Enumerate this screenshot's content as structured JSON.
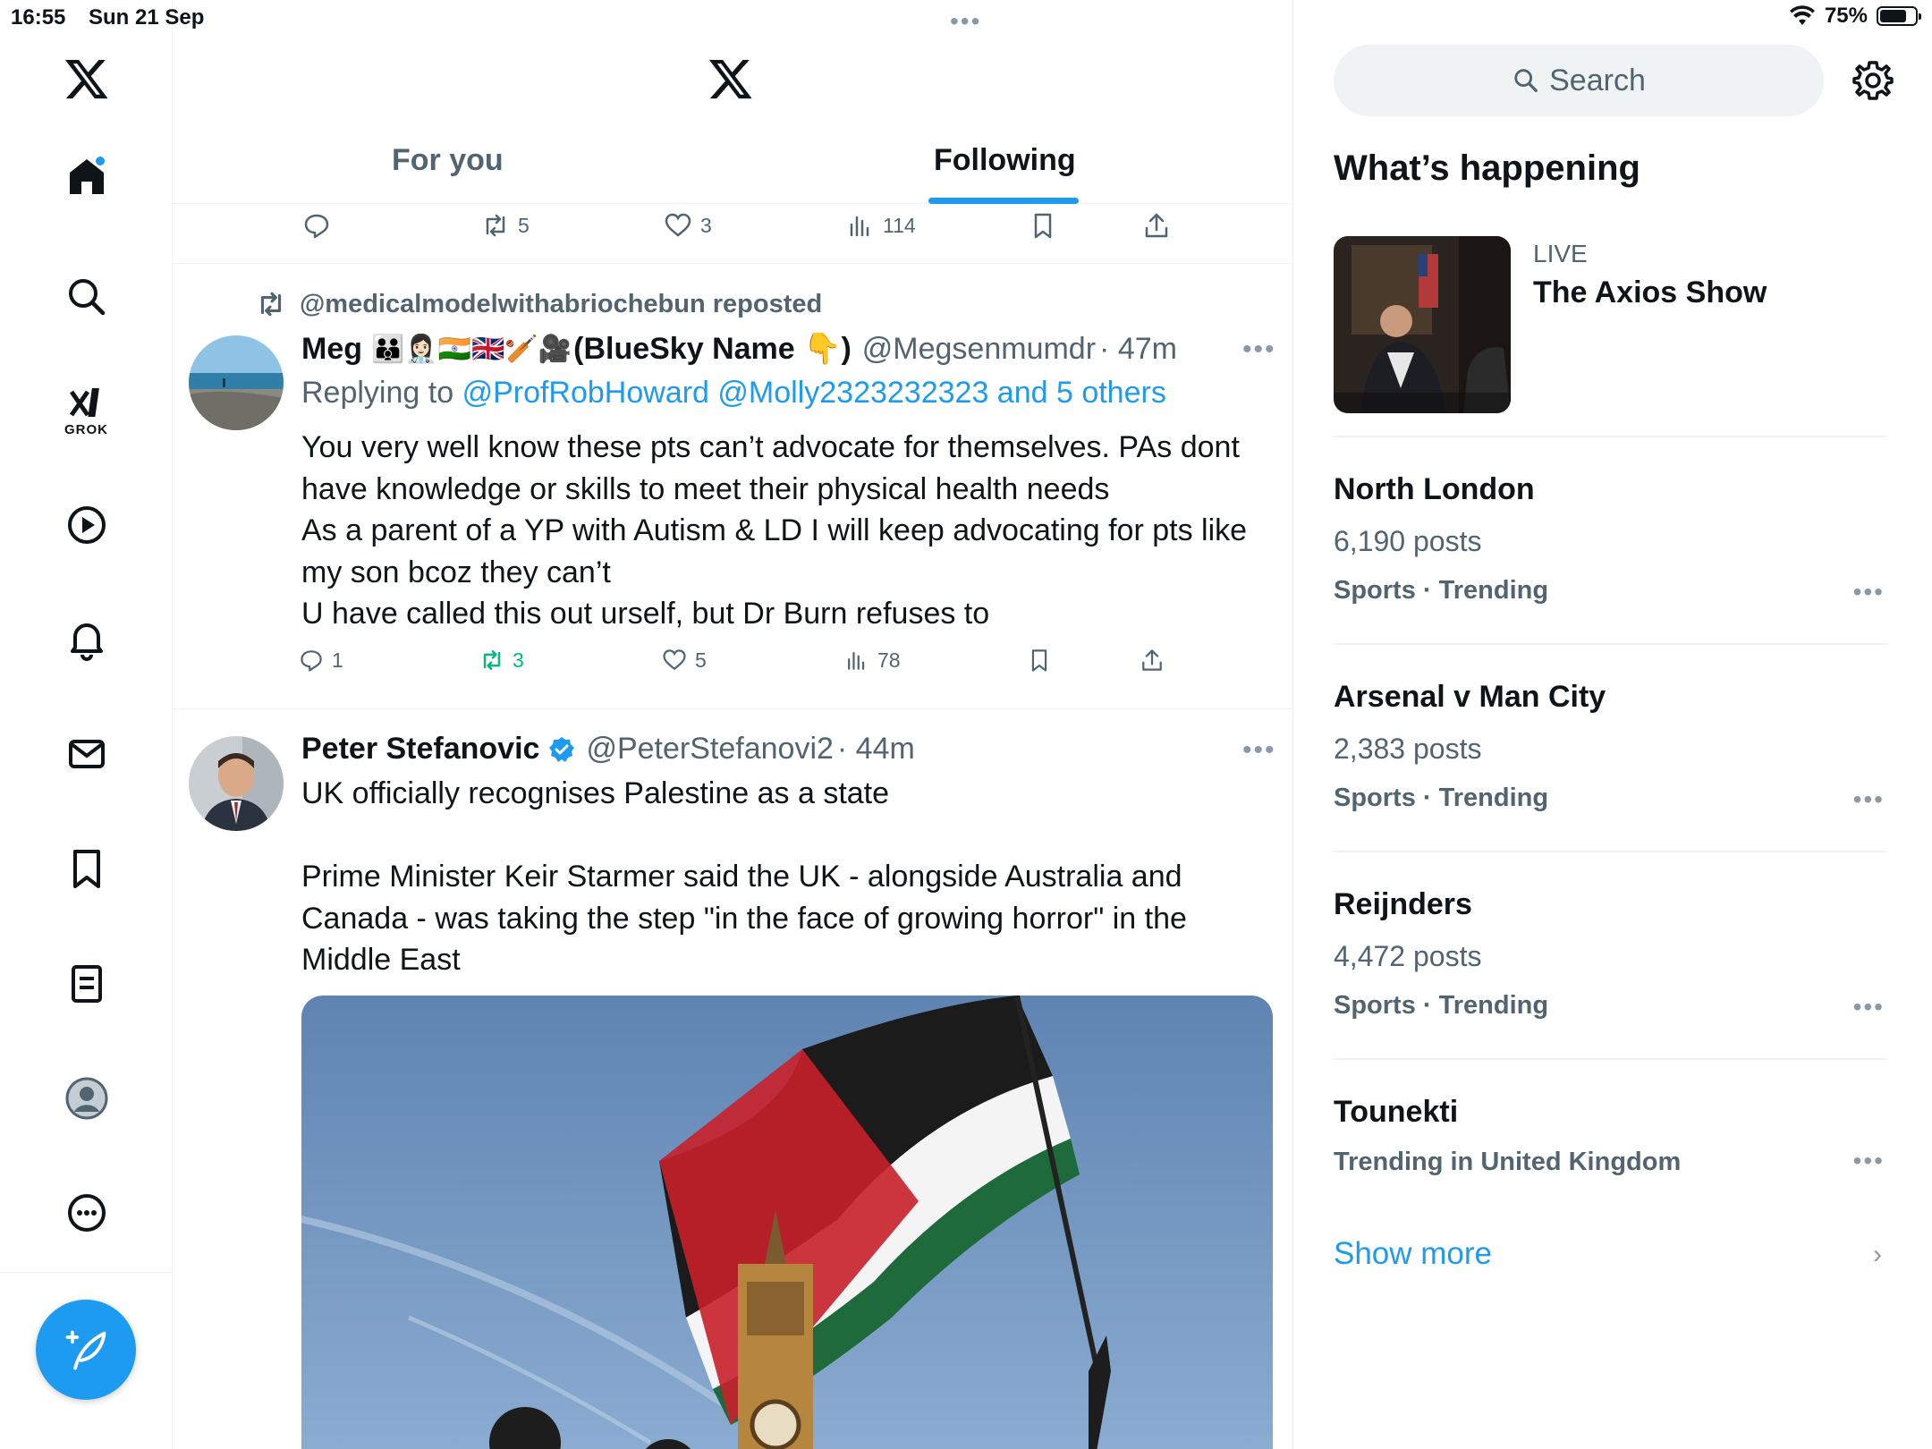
{
  "status_bar": {
    "time": "16:55",
    "date": "Sun 21 Sep",
    "battery": "75%",
    "battery_level": 0.75
  },
  "nav": {
    "items": [
      "home-icon",
      "search-icon",
      "grok-icon",
      "video-icon",
      "notifications-icon",
      "messages-icon",
      "bookmarks-icon",
      "lists-icon",
      "profile-icon",
      "more-icon"
    ],
    "grok_label": "GROK"
  },
  "header": {
    "tabs": [
      {
        "label": "For you",
        "active": false
      },
      {
        "label": "Following",
        "active": true
      }
    ]
  },
  "top_actions": {
    "reposts": "5",
    "likes": "3",
    "views": "114"
  },
  "post1": {
    "repost_by": "@medicalmodelwithabriochebun reposted",
    "name": "Meg",
    "name_emojis": "🧑‍🧑‍🧒👩🏻‍⚕️🇮🇳🇬🇧🏏🎥",
    "name_suffix": "(BlueSky Name 👇)",
    "handle": "@Megsenmumdr",
    "time": "· 47m",
    "replying_prefix": "Replying to",
    "replying_to": "@ProfRobHoward @Molly2323232323 and 5 others",
    "lines": [
      "You very well know these pts can’t advocate for themselves. PAs dont",
      "have knowledge or skills to meet their physical health needs",
      "As a parent of a YP with Autism & LD I will keep advocating for pts like",
      "my son bcoz they can’t",
      "U have called this out urself, but Dr Burn refuses to"
    ],
    "replies": "1",
    "reposts": "3",
    "likes": "5",
    "views": "78"
  },
  "post2": {
    "name": "Peter Stefanovic",
    "handle": "@PeterStefanovi2",
    "time": "· 44m",
    "lines": [
      "UK officially recognises Palestine as a state",
      "",
      "Prime Minister Keir Starmer said the UK - alongside Australia and",
      "Canada - was taking the step \"in the face of growing horror\" in the",
      "Middle East"
    ]
  },
  "sidebar": {
    "search_placeholder": "Search",
    "whats_happening": "What’s happening",
    "live_label": "LIVE",
    "live_title": "The Axios Show",
    "trends": [
      {
        "title": "North London",
        "posts": "6,190 posts",
        "meta": "Sports · Trending"
      },
      {
        "title": "Arsenal v Man City",
        "posts": "2,383 posts",
        "meta": "Sports · Trending"
      },
      {
        "title": "Reijnders",
        "posts": "4,472 posts",
        "meta": "Sports · Trending"
      },
      {
        "title": "Tounekti",
        "posts": "",
        "meta": "Trending in United Kingdom"
      }
    ],
    "show_more": "Show more"
  },
  "colors": {
    "accent": "#1d9bf0",
    "repost_green": "#00ba7c",
    "muted": "#536471",
    "text": "#0f1419"
  }
}
